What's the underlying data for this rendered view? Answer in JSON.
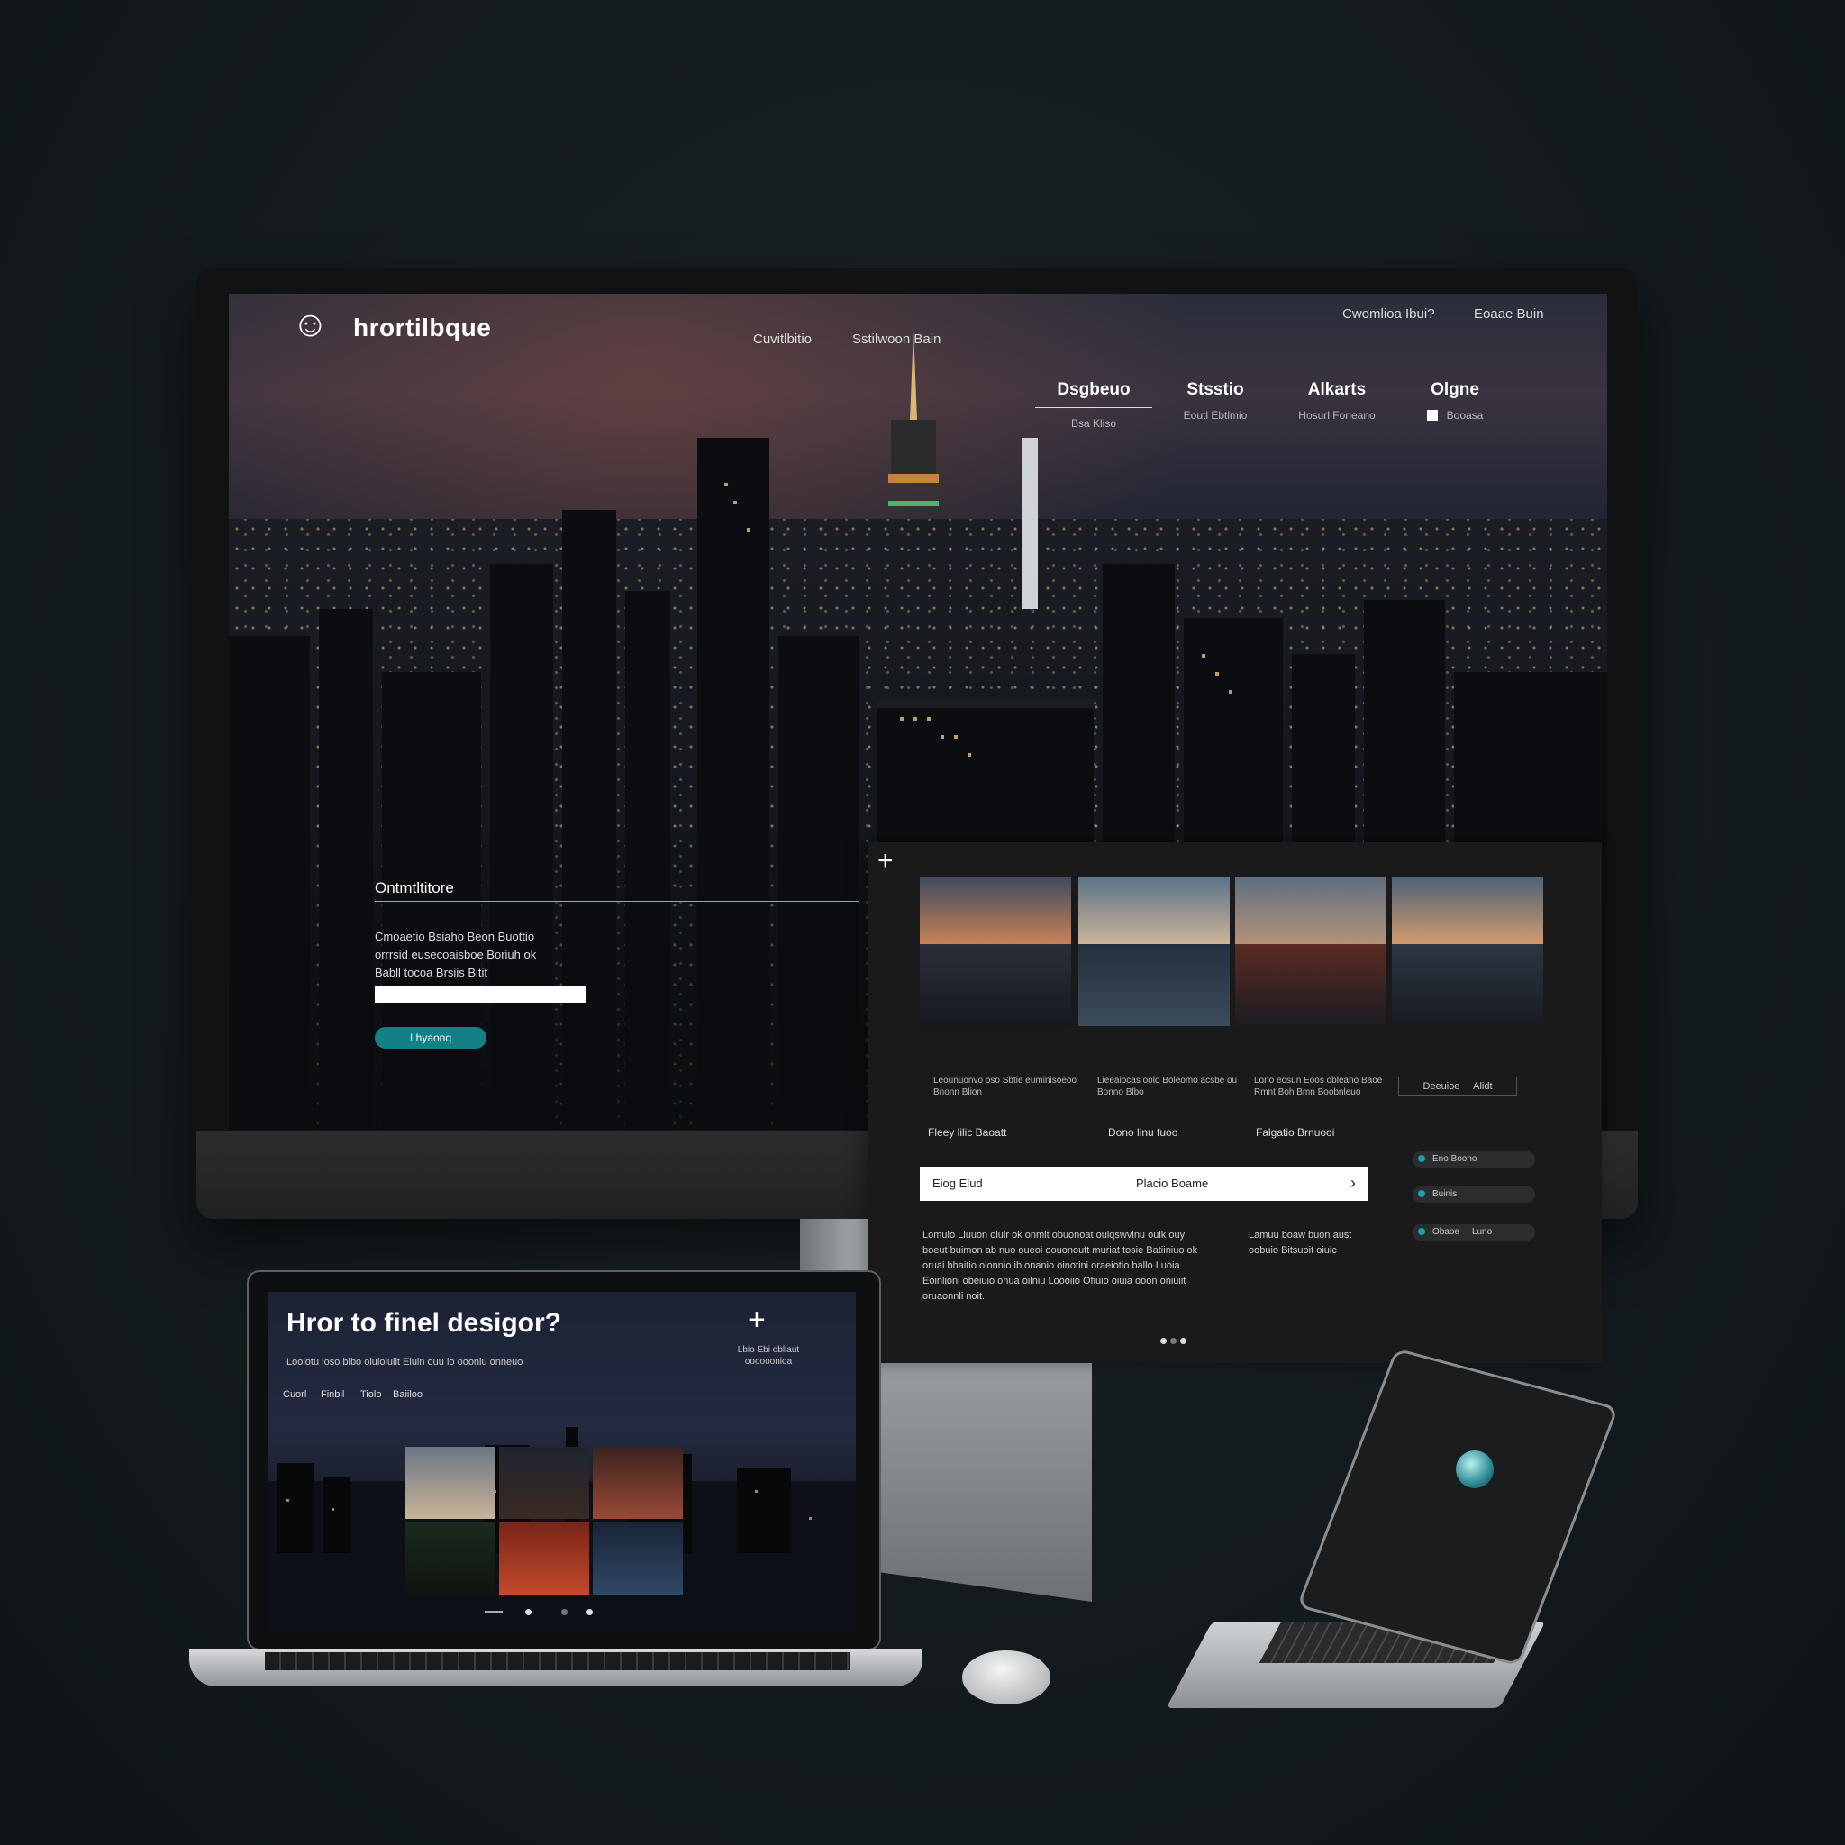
{
  "monitor": {
    "brand": {
      "name": "hrortilbque"
    },
    "top_links": [
      "Cwomlioa Ibui?",
      "Eoaae Buin"
    ],
    "mid_links": [
      "Cuvitlbitio",
      "Sstilwoon Bain"
    ],
    "tabs": [
      {
        "title": "Dsgbeuo",
        "sub": "Bsa Kliso",
        "active": true
      },
      {
        "title": "Stsstio",
        "sub": "Eoutl Ebtlmio",
        "active": false
      },
      {
        "title": "Alkarts",
        "sub": "Hosurl Foneano",
        "active": false
      },
      {
        "title": "Olgne",
        "sub": "Booasa",
        "active": false
      }
    ],
    "contact": {
      "title": "Ontmtltitore",
      "text_lines": [
        "Cmoaetio Bsiaho Beon Buottio",
        "orrrsid eusecoaisboe Boriuh ok",
        "Babll tocoa Brsiis Bitit"
      ],
      "input_value": "",
      "button": "Lhyaonq"
    }
  },
  "gallery": {
    "captions": [
      "Leounuonvo oso Sbtie euminisoeoo Bnonn Blion",
      "Lieeaiocas oolo Boleomo acsbe ou Bonno Blbo",
      "Lono eosun Eoos obleano Baoe Rmnt Boh Bmn Boobnleuo"
    ],
    "mini_button": {
      "left": "Deeuioe",
      "right": "Alidt"
    },
    "sub_labels": [
      "Fleey lilic Baoatt",
      "Dono linu fuoo",
      "Falgatio Brnuooi"
    ],
    "search": {
      "left": "Eiog Elud",
      "middle": "Placio Boame",
      "chevron": "›"
    },
    "paragraph_left": "Lomuio Liuuon oiuir ok onmit obuonoat ouiqswvinu ouik ouy boeut buimon ab nuo oueoi oouonoutt muriat tosie Batiiniuo ok oruai bhaitio oionnio ib onanio oinotini oraeiotio ballo Luoia Eoinlioni obeiuio onua oilniu Loooiio Ofiuio oiuia ooon oniuiit oruaonnli noit.",
    "paragraph_right": "Lamuu boaw buon aust oobuio Bitsuoit oiuic",
    "pills": [
      {
        "label": "Eno Boono",
        "extra": ""
      },
      {
        "label": "Buinis",
        "extra": ""
      },
      {
        "label": "Obaoe",
        "extra": "Luno"
      }
    ]
  },
  "laptop": {
    "title": "Hror to finel desigor?",
    "subtitle": "Looiotu loso bibo oiuloiuiit Eiuin ouu io oooniu onneuo",
    "nav": [
      "Cuorl",
      "Finbil",
      "Tiolo",
      "Baiiloo"
    ],
    "plus_caption": "Lbio Ebi obliaut oooooonioa"
  },
  "colors": {
    "accent": "#137f86",
    "panel": "#1a1a1b",
    "background": "#141b1e"
  }
}
